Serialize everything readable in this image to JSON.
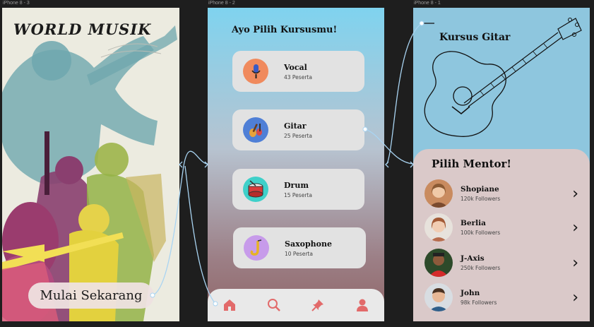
{
  "frames": {
    "frame1": "iPhone 8 - 3",
    "frame2": "iPhone 8 - 2",
    "frame3": "iPhone 8 - 1"
  },
  "screen1": {
    "title": "WORLD MUSIK",
    "start_button": "Mulai Sekarang"
  },
  "screen2": {
    "title": "Ayo Pilih Kursusmu!",
    "courses": [
      {
        "name": "Vocal",
        "count": "43 Peserta",
        "icon": "microphone-icon",
        "color": "#f08a5d"
      },
      {
        "name": "Gitar",
        "count": "25 Peserta",
        "icon": "guitar-icon",
        "color": "#4f7fd6"
      },
      {
        "name": "Drum",
        "count": "15 Peserta",
        "icon": "drum-icon",
        "color": "#3fd0c9"
      },
      {
        "name": "Saxophone",
        "count": "10 Peserta",
        "icon": "saxophone-icon",
        "color": "#c79bea"
      }
    ],
    "nav": [
      "home-icon",
      "search-icon",
      "pin-icon",
      "user-icon"
    ],
    "nav_color": "#e26a6a"
  },
  "screen3": {
    "title": "Kursus Gitar",
    "panel_title": "Pilih Mentor!",
    "mentors": [
      {
        "name": "Shopiane",
        "followers": "120k Followers"
      },
      {
        "name": "Berlia",
        "followers": "100k Followers"
      },
      {
        "name": "J-Axis",
        "followers": "250k Followers"
      },
      {
        "name": "John",
        "followers": "98k Followers"
      }
    ]
  }
}
